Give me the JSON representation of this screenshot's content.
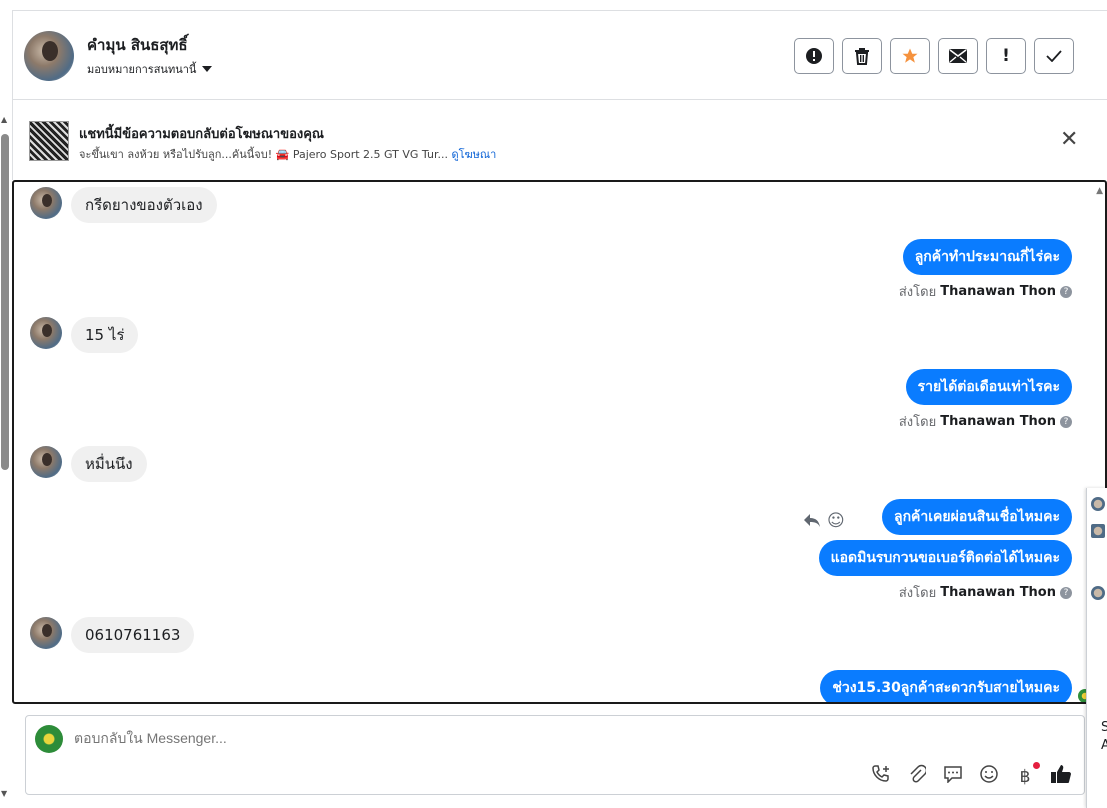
{
  "header": {
    "contact_name": "คำมุน สินธสุทธิ์",
    "assign_label": "มอบหมายการสนทนานี้",
    "actions": [
      {
        "name": "spam-button",
        "glyph": "!",
        "style": "circle"
      },
      {
        "name": "delete-button",
        "glyph": "🗑"
      },
      {
        "name": "star-button",
        "glyph": "★"
      },
      {
        "name": "mark-unread-button",
        "glyph": "✉"
      },
      {
        "name": "follow-up-button",
        "glyph": "!"
      },
      {
        "name": "mark-done-button",
        "glyph": "✓"
      }
    ]
  },
  "ad": {
    "title": "แชทนี้มีข้อความตอบกลับต่อโฆษณาของคุณ",
    "subtitle": "จะขึ้นเขา ลงห้วย หรือไปรับลูก...คันนี้จบ! 🚘 Pajero Sport 2.5 GT VG Tur...",
    "view_ad_link": "ดูโฆษณา",
    "close_glyph": "✕"
  },
  "messages": {
    "m1": "กรีดยางของตัวเอง",
    "m2": "ลูกค้าทำประมาณกี่ไร่คะ",
    "m3": "15 ไร่",
    "m4": "รายได้ต่อเดือนเท่าไรคะ",
    "m5": "หมื่นนึง",
    "m6": "ลูกค้าเคยผ่อนสินเชื่อไหมคะ",
    "m7": "แอดมินรบกวนขอเบอร์ติดต่อได้ไหมคะ",
    "m8": "0610761163",
    "m9": "ช่วง15.30ลูกค้าสะดวกรับสายไหมคะ"
  },
  "sent_by": {
    "prefix": "ส่งโดย",
    "agent": "Thanawan Thon"
  },
  "composer": {
    "placeholder": "ตอบกลับใน Messenger..."
  },
  "side_panel": {
    "letter_s": "S",
    "letter_a": "A"
  },
  "colors": {
    "outgoing_bubble": "#0a7cff",
    "incoming_bubble": "#f0f0f0",
    "star": "#f5923e",
    "link": "#0b62d6"
  }
}
